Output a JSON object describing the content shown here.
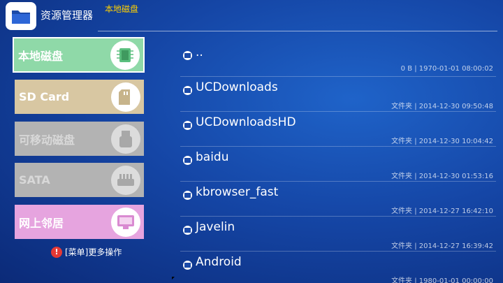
{
  "header": {
    "app_title": "资源管理器",
    "breadcrumb": "本地磁盘",
    "app_icon": "folder-icon"
  },
  "sidebar": {
    "items": [
      {
        "label": "本地磁盘",
        "icon": "chip-icon",
        "color": "#8fd9a8",
        "selected": true
      },
      {
        "label": "SD Card",
        "icon": "sd-card-icon",
        "color": "#d8c7a2"
      },
      {
        "label": "可移动磁盘",
        "icon": "usb-icon",
        "color": "#b3b3b3",
        "disabled": true
      },
      {
        "label": "SATA",
        "icon": "sata-icon",
        "color": "#b3b3b3",
        "disabled": true
      },
      {
        "label": "网上邻居",
        "icon": "network-monitor-icon",
        "color": "#e6a4df"
      }
    ],
    "menu_hint": "[菜单]更多操作"
  },
  "files": [
    {
      "name": "..",
      "meta": "0 B | 1970-01-01 08:00:02"
    },
    {
      "name": "UCDownloads",
      "meta": "文件夹 | 2014-12-30 09:50:48"
    },
    {
      "name": "UCDownloadsHD",
      "meta": "文件夹 | 2014-12-30 10:04:42"
    },
    {
      "name": "baidu",
      "meta": "文件夹 | 2014-12-30 01:53:16"
    },
    {
      "name": "kbrowser_fast",
      "meta": "文件夹 | 2014-12-27 16:42:10"
    },
    {
      "name": "Javelin",
      "meta": "文件夹 | 2014-12-27 16:39:42"
    },
    {
      "name": "Android",
      "meta": "文件夹 | 1980-01-01 00:00:00"
    }
  ],
  "colors": {
    "accent": "#ffd000",
    "background": "#1546a6"
  }
}
